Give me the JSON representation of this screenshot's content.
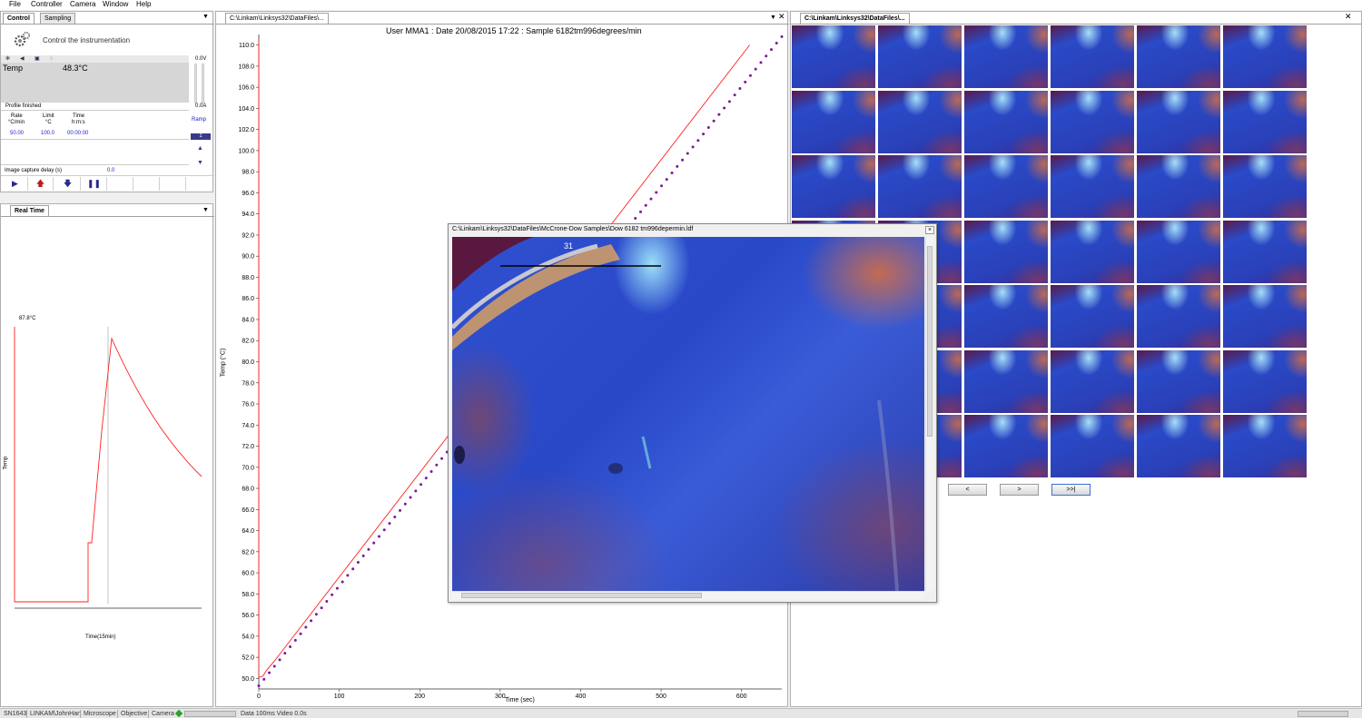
{
  "menu": [
    "File",
    "Controller",
    "Camera",
    "Window",
    "Help"
  ],
  "control_panel": {
    "tabs": [
      "Control",
      "Sampling"
    ],
    "description": "Control the instrumentation",
    "temp_label": "Temp",
    "temp_value": "48.3°C",
    "volt_top": "0.0V",
    "volt_bottom": "0.0A",
    "status": "Profile finished",
    "ramp_label": "Ramp",
    "ramp_number": "1",
    "headers": {
      "rate": "Rate",
      "rate_unit": "°C/min",
      "limit": "Limit",
      "limit_unit": "°C",
      "time": "Time",
      "time_unit": "h:m:s"
    },
    "values": {
      "rate": "50.00",
      "limit": "100.0",
      "time": "00:00:00"
    },
    "capture_label": "Image capture delay (s)",
    "capture_value": "0.0"
  },
  "realtime_panel": {
    "tab": "Real Time",
    "peak_label": "87.8°C",
    "ylabel": "Temp",
    "xlabel": "Time(15min)"
  },
  "graph_panel": {
    "tab": "C:\\Linkam\\Linksys32\\DataFiles\\...",
    "header": "User MMA1 : Date 20/08/2015 17:22 : Sample 6182tm996degrees/min"
  },
  "chart_data": {
    "type": "line",
    "xlabel": "Time (sec)",
    "ylabel": "Temp (°C)",
    "xlim": [
      0,
      650
    ],
    "ylim": [
      49,
      111
    ],
    "x_ticks": [
      0,
      100,
      200,
      300,
      400,
      500,
      600
    ],
    "y_ticks": [
      "50.0",
      "52.0",
      "54.0",
      "56.0",
      "58.0",
      "60.0",
      "62.0",
      "64.0",
      "66.0",
      "68.0",
      "70.0",
      "72.0",
      "74.0",
      "76.0",
      "78.0",
      "80.0",
      "82.0",
      "84.0",
      "86.0",
      "88.0",
      "90.0",
      "92.0",
      "94.0",
      "96.0",
      "98.0",
      "100.0",
      "102.0",
      "104.0",
      "106.0",
      "108.0",
      "110.0"
    ],
    "series": [
      {
        "color": "#ff2020",
        "style": "line",
        "x": [
          0,
          5,
          10,
          20,
          610
        ],
        "y": [
          50.1,
          50.2,
          50.8,
          51.7,
          110.0
        ]
      },
      {
        "color": "#7a1a9a",
        "style": "dots",
        "x": [
          0,
          20,
          650
        ],
        "y": [
          49.3,
          51.2,
          110.8
        ]
      }
    ]
  },
  "thumb_panel": {
    "tab": "C:\\Linkam\\Linksys32\\DataFiles\\...",
    "buttons": [
      "<",
      ">",
      ">>|"
    ]
  },
  "image_window": {
    "title": "C:\\Linkam\\Linksys32\\DataFiles\\McCrone-Dow Samples\\Dow 6182 tm996depermin.ldf",
    "overlay_text": "31"
  },
  "statusbar": [
    "SN1643",
    "LINKAM\\JohnHart",
    "Microscope",
    "Objective",
    "Camera",
    "Data 100ms Video 0.0s"
  ],
  "colors": {
    "red_trace": "#ff2020",
    "purple_trace": "#7a1a9a",
    "ramp_badge": "#3a3a8a"
  }
}
